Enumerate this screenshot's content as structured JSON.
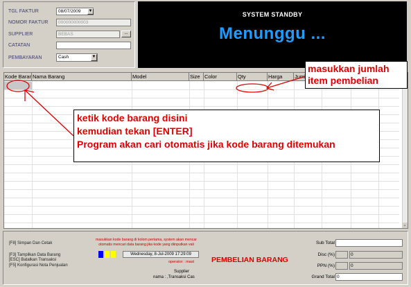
{
  "form": {
    "tgl_faktur_label": "TGL FAKTUR",
    "tgl_faktur_value": "08/07/2009",
    "nomor_faktur_label": "NOMOR FAKTUR",
    "nomor_faktur_value": "000000000003",
    "supplier_label": "SUPPLIER",
    "supplier_value": "BEBAS",
    "supplier_browse": "...",
    "catatan_label": "CATATAN",
    "catatan_value": "",
    "pembayaran_label": "PEMBAYARAN",
    "pembayaran_value": "Cash"
  },
  "status": {
    "title": "SYSTEM STANDBY",
    "message": "Menunggu ..."
  },
  "grid": {
    "columns": [
      "Kode Barang",
      "Nama Barang",
      "Model",
      "Size",
      "Color",
      "Qty",
      "Harga",
      "Jumlah"
    ]
  },
  "annotations": {
    "qty_line1": "masukkan jumlah",
    "qty_line2": "item pembelian",
    "kode_line1": "ketik kode barang disini",
    "kode_line2": "kemudian tekan [ENTER]",
    "kode_line3": "Program akan cari otomatis jika kode barang ditemukan"
  },
  "footer": {
    "hotkeys": [
      "[F8] Simpan Dan Cetak",
      "[F3] Tampilkan Data Barang",
      "[ESC] Batalkan Transaksi",
      "[F5] Konfigurasi Nota Penjualan"
    ],
    "hint_line1": "masukkan kode barang di kolom pertama, system akan mencar",
    "hint_line2": "otomatis mencari data barang jika kode yang diinputkan vali",
    "datetime": "Wednesday, 8-Jul-2009  17:29:09",
    "operator": "operator : mast",
    "supplier_line1": "Supplier",
    "supplier_line2": "nama : ,Transaksi Cas",
    "module_title": "PEMBELIAN BARANG",
    "indicator_colors": [
      "#0000ff",
      "#ffff00",
      "#ffff00"
    ],
    "sub_total_label": "Sub Total",
    "sub_total_value": "",
    "disc_label": "Disc (%)",
    "disc_pct": "",
    "disc_value": "0",
    "ppn_label": "PPN (%)",
    "ppn_pct": "",
    "ppn_value": "0",
    "grand_total_label": "Grand Total",
    "grand_total_value": "0"
  },
  "icons": {
    "dropdown": "chevron-down-icon",
    "scroll_down": "scroll-down-icon"
  }
}
